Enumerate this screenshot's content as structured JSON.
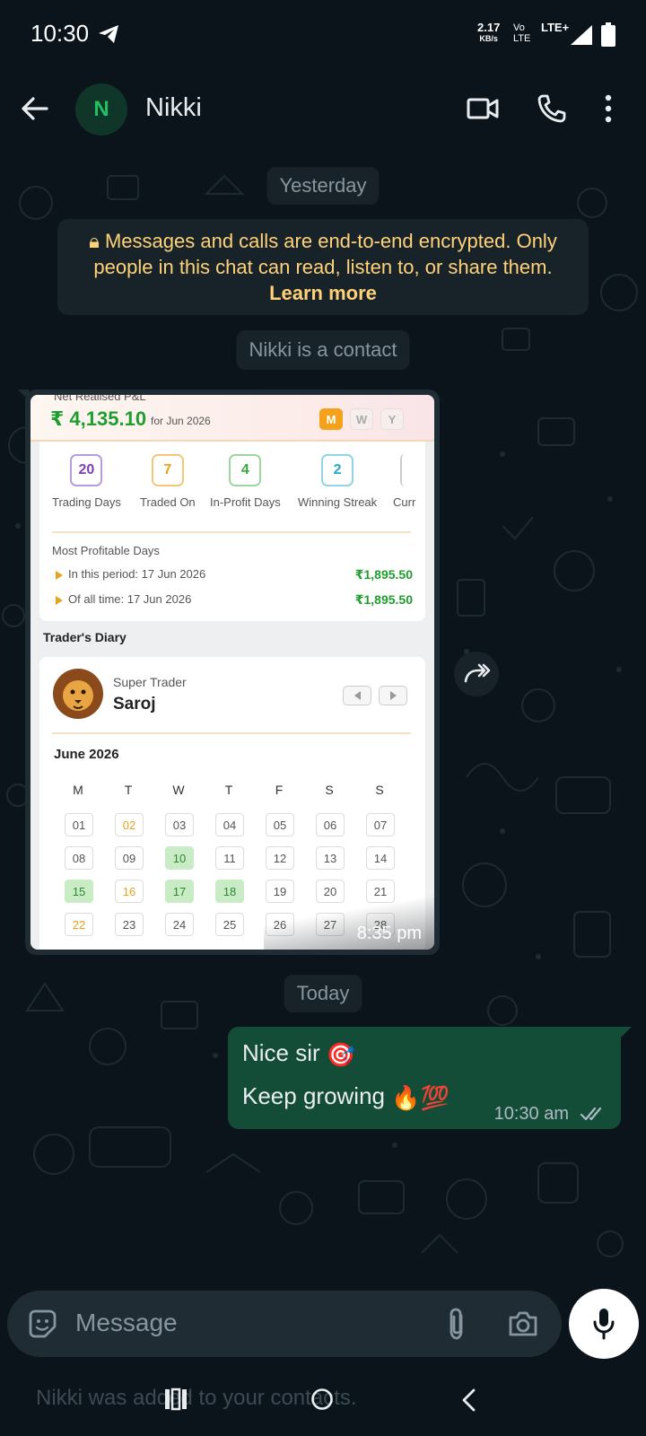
{
  "status_bar": {
    "time": "10:30",
    "speed_value": "2.17",
    "speed_unit": "KB/s",
    "volte_top": "Vo",
    "volte_bottom": "LTE",
    "network": "LTE+"
  },
  "header": {
    "avatar_initial": "N",
    "contact_name": "Nikki",
    "icons": [
      "back-arrow-icon",
      "video-call-icon",
      "voice-call-icon",
      "more-options-icon"
    ]
  },
  "chat": {
    "date_yesterday": "Yesterday",
    "encryption_notice": "Messages and calls are end-to-end encrypted. Only people in this chat can read, listen to, or share them.",
    "learn_more": "Learn more",
    "contact_info": "Nikki is a contact",
    "image_time": "8:35 pm",
    "date_today": "Today",
    "outgoing": {
      "line1": "Nice sir",
      "line1_emoji": "🎯",
      "line2": "Keep growing",
      "line2_emoji": "🔥💯",
      "time": "10:30 am",
      "status": "read"
    }
  },
  "screenshot": {
    "pnl_title": "Net Realised P&L",
    "pnl_value": "₹ 4,135.10",
    "pnl_period": "for Jun 2026",
    "period_buttons": [
      "M",
      "W",
      "Y"
    ],
    "stats": [
      {
        "value": "20",
        "label": "Trading Days",
        "color": "#7b3fb5"
      },
      {
        "value": "7",
        "label": "Traded On",
        "color": "#e8a11c"
      },
      {
        "value": "4",
        "label": "In-Profit Days",
        "color": "#3aa83a"
      },
      {
        "value": "2",
        "label": "Winning Streak",
        "color": "#27a6c9"
      },
      {
        "value": "",
        "label": "Curr",
        "color": "#cccccc"
      }
    ],
    "most_profitable_title": "Most Profitable Days",
    "mp_rows": [
      {
        "label": "In this period: 17 Jun 2026",
        "value": "₹1,895.50"
      },
      {
        "label": "Of all time: 17 Jun 2026",
        "value": "₹1,895.50"
      }
    ],
    "diary_title": "Trader's Diary",
    "badge_label": "Super Trader",
    "trader_name": "Saroj",
    "month": "June 2026",
    "weekdays": [
      "M",
      "T",
      "W",
      "T",
      "F",
      "S",
      "S"
    ],
    "days": [
      {
        "d": "01",
        "s": ""
      },
      {
        "d": "02",
        "s": "orange"
      },
      {
        "d": "03",
        "s": ""
      },
      {
        "d": "04",
        "s": ""
      },
      {
        "d": "05",
        "s": ""
      },
      {
        "d": "06",
        "s": ""
      },
      {
        "d": "07",
        "s": ""
      },
      {
        "d": "08",
        "s": ""
      },
      {
        "d": "09",
        "s": ""
      },
      {
        "d": "10",
        "s": "green"
      },
      {
        "d": "11",
        "s": ""
      },
      {
        "d": "12",
        "s": ""
      },
      {
        "d": "13",
        "s": ""
      },
      {
        "d": "14",
        "s": ""
      },
      {
        "d": "15",
        "s": "green"
      },
      {
        "d": "16",
        "s": "orange"
      },
      {
        "d": "17",
        "s": "green"
      },
      {
        "d": "18",
        "s": "green"
      },
      {
        "d": "19",
        "s": ""
      },
      {
        "d": "20",
        "s": ""
      },
      {
        "d": "21",
        "s": ""
      },
      {
        "d": "22",
        "s": "orange"
      },
      {
        "d": "23",
        "s": ""
      },
      {
        "d": "24",
        "s": ""
      },
      {
        "d": "25",
        "s": ""
      },
      {
        "d": "26",
        "s": ""
      },
      {
        "d": "27",
        "s": ""
      },
      {
        "d": "28",
        "s": ""
      }
    ]
  },
  "input": {
    "placeholder": "Message"
  },
  "bottom": {
    "toast": "Nikki was added to your contacts."
  },
  "colors": {
    "background": "#0b141a",
    "outgoing_bubble": "#144d37",
    "incoming_bubble": "#202c33",
    "accent_green": "#21c063",
    "encryption_text": "#ffd279"
  }
}
